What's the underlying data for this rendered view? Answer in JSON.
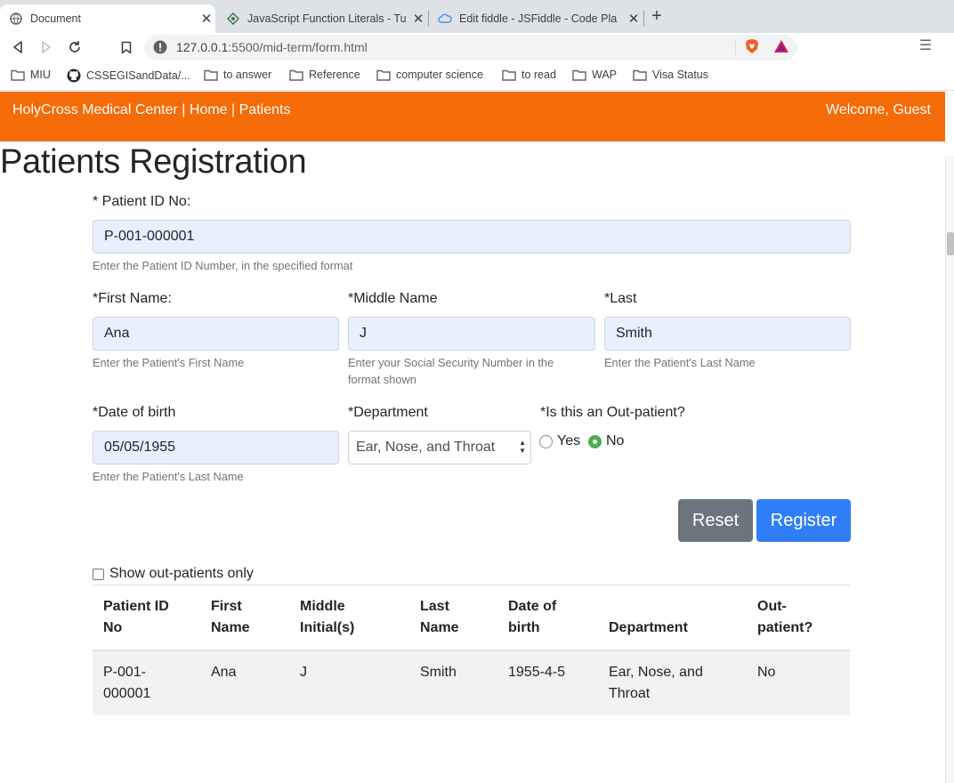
{
  "browser": {
    "tabs": [
      {
        "title": "Document",
        "active": true,
        "icon": "globe-icon"
      },
      {
        "title": "JavaScript Function Literals - Tu",
        "active": false,
        "icon": "diamond-icon"
      },
      {
        "title": "Edit fiddle - JSFiddle - Code Pla",
        "active": false,
        "icon": "cloud-icon"
      }
    ],
    "url_host": "127.0.0.1",
    "url_rest": ":5500/mid-term/form.html",
    "bookmarks": [
      "MIU",
      "CSSEGISandData/...",
      "to answer",
      "Reference",
      "computer science",
      "to read",
      "WAP",
      "Visa Status"
    ]
  },
  "navbar": {
    "brand": "HolyCross Medical Center",
    "sep": " | ",
    "home": "Home",
    "patients": "Patients",
    "welcome": "Welcome, Guest"
  },
  "page": {
    "title": "Patients Registration"
  },
  "form": {
    "patient_id": {
      "label": "* Patient ID No:",
      "value": "P-001-000001",
      "help": "Enter the Patient ID Number, in the specified format"
    },
    "first_name": {
      "label": "*First Name:",
      "value": "Ana",
      "help": "Enter the Patient's First Name"
    },
    "middle_name": {
      "label": "*Middle Name",
      "value": "J",
      "help": "Enter your Social Security Number in the format shown"
    },
    "last_name": {
      "label": "*Last",
      "value": "Smith",
      "help": "Enter the Patient's Last Name"
    },
    "dob": {
      "label": "*Date of birth",
      "value": "05/05/1955",
      "help": "Enter the Patient's Last Name"
    },
    "department": {
      "label": "*Department",
      "value": "Ear, Nose, and Throat"
    },
    "outpatient": {
      "label": "*Is this an Out-patient?",
      "yes": "Yes",
      "no": "No",
      "selected": "No"
    },
    "reset_label": "Reset",
    "register_label": "Register",
    "filter_label": "Show out-patients only"
  },
  "table": {
    "headers": [
      "Patient ID No",
      "First Name",
      "Middle Initial(s)",
      "Last Name",
      "Date of birth",
      "Department",
      "Out-patient?"
    ],
    "rows": [
      [
        "P-001-000001",
        "Ana",
        "J",
        "Smith",
        "1955-4-5",
        "Ear, Nose, and Throat",
        "No"
      ]
    ]
  },
  "colors": {
    "navbar": "#f46b07",
    "reset": "#6c757d",
    "register": "#2f7ef7",
    "autofill": "#e8f0fe"
  }
}
